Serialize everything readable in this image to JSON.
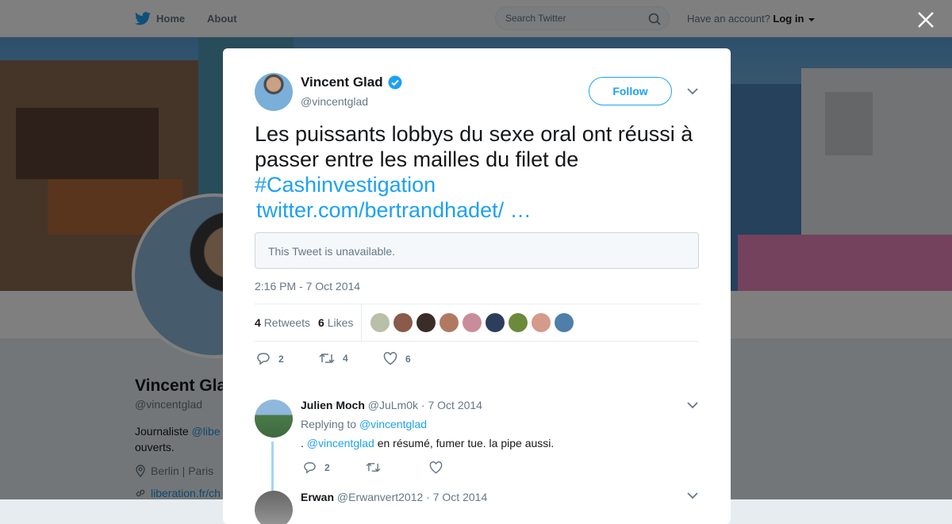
{
  "topbar": {
    "home_label": "Home",
    "about_label": "About",
    "search_placeholder": "Search Twitter",
    "have_account": "Have an account?",
    "login_label": "Log in"
  },
  "background_profile": {
    "name": "Vincent Glad",
    "handle": "@vincentglad",
    "bio_prefix": "Journaliste ",
    "bio_link": "@libe",
    "bio_line2": "ouverts.",
    "location": "Berlin | Paris",
    "url": "liberation.fr/ch"
  },
  "tweet": {
    "author_name": "Vincent Glad",
    "author_handle": "@vincentglad",
    "follow_label": "Follow",
    "text": "Les puissants lobbys du sexe oral ont réussi à passer entre les mailles du filet de",
    "hashtag": "#Cashinvestigation",
    "link": "twitter.com/bertrandhadet/ …",
    "unavailable_text": "This Tweet is unavailable.",
    "timestamp": "2:16 PM - 7 Oct 2014",
    "retweets_count": "4",
    "retweets_label": "Retweets",
    "likes_count": "6",
    "likes_label": "Likes",
    "actions": {
      "replies": "2",
      "retweets": "4",
      "likes": "6"
    }
  },
  "likers": [
    {
      "color": "#b9c0a8"
    },
    {
      "color": "#8a5a4a"
    },
    {
      "color": "#3a2c28"
    },
    {
      "color": "#b07a62"
    },
    {
      "color": "#c98c9a"
    },
    {
      "color": "#2c3e5c"
    },
    {
      "color": "#6b8a3a"
    },
    {
      "color": "#d49a8a"
    },
    {
      "color": "#4d7fa8"
    }
  ],
  "replies": [
    {
      "name": "Julien Moch",
      "handle": "@JuLm0k",
      "date": "· 7 Oct 2014",
      "replying_prefix": "Replying to ",
      "replying_to": "@vincentglad",
      "text_prefix": ". ",
      "mention": "@vincentglad",
      "text_suffix": " en résumé, fumer tue. la pipe aussi.",
      "reply_count": "2"
    },
    {
      "name": "Erwan",
      "handle": "@Erwanvert2012",
      "date": "· 7 Oct 2014"
    }
  ],
  "colors": {
    "accent": "#1da1f2",
    "thread": "#a3d4f7"
  }
}
